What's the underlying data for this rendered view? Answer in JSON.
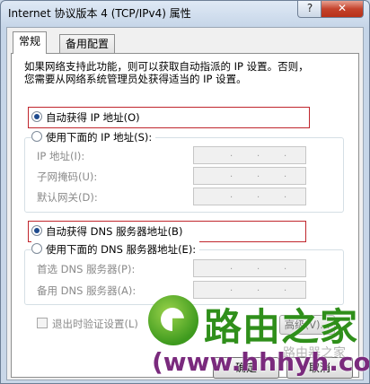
{
  "window": {
    "title": "Internet 协议版本 4 (TCP/IPv4) 属性",
    "help_label": "?",
    "close_label": "✕"
  },
  "tabs": [
    {
      "label": "常规",
      "active": true
    },
    {
      "label": "备用配置",
      "active": false
    }
  ],
  "intro": {
    "line1": "如果网络支持此功能，则可以获取自动指派的 IP 设置。否则，",
    "line2": "您需要从网络系统管理员处获得适当的 IP 设置。"
  },
  "ip_section": {
    "auto_label": "自动获得 IP 地址(O)",
    "auto_selected": true,
    "manual_label": "使用下面的 IP 地址(S):",
    "fields": [
      {
        "label": "IP 地址(I):",
        "value": ". . ."
      },
      {
        "label": "子网掩码(U):",
        "value": ". . ."
      },
      {
        "label": "默认网关(D):",
        "value": ". . ."
      }
    ]
  },
  "dns_section": {
    "auto_label": "自动获得 DNS 服务器地址(B)",
    "auto_selected": true,
    "manual_label": "使用下面的 DNS 服务器地址(E):",
    "fields": [
      {
        "label": "首选 DNS 服务器(P):",
        "value": ". . ."
      },
      {
        "label": "备用 DNS 服务器(A):",
        "value": ". . ."
      }
    ]
  },
  "validate_label": "退出时验证设置(L)",
  "advanced_label": "高级(V)...",
  "ok_label": "确定",
  "cancel_label": "取消",
  "watermark": {
    "brand": "路由之家",
    "url": "(www.hhhyh.com)",
    "sub": "路由器之家"
  },
  "colors": {
    "highlight_box": "#c0262d",
    "brand_green": "#2f8f1a",
    "url_purple": "#7a2a7d"
  }
}
